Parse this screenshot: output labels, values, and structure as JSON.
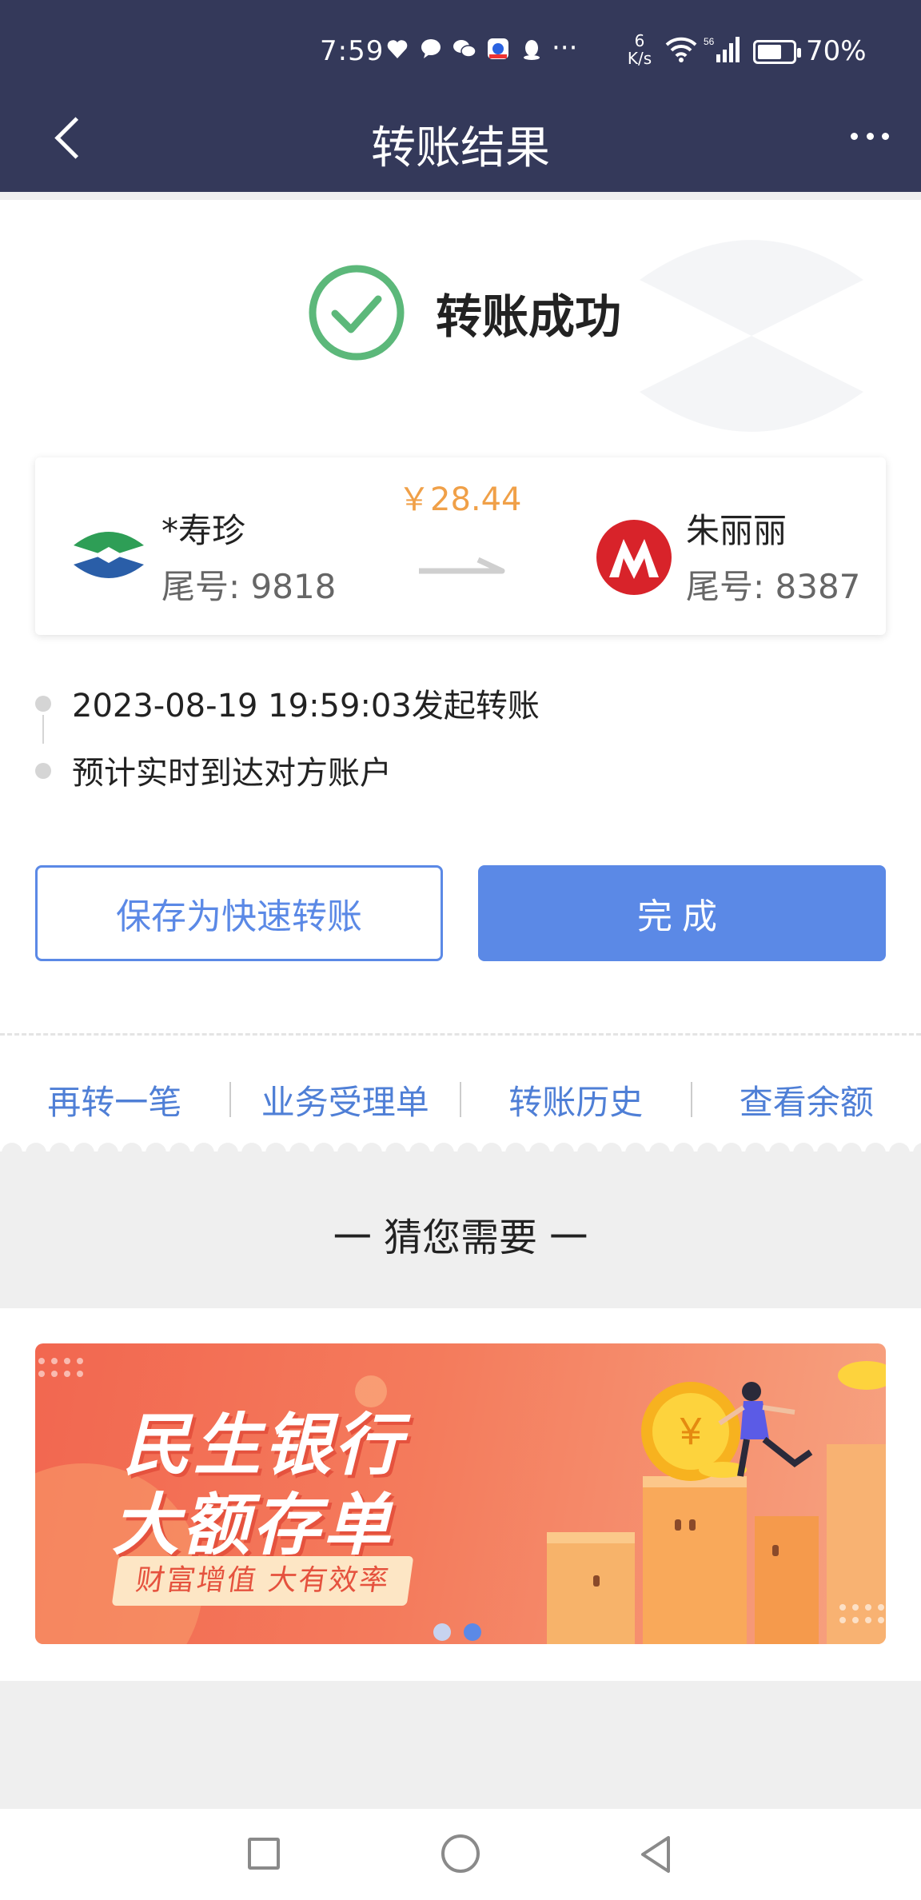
{
  "status_bar": {
    "time": "7:59",
    "more": "···",
    "net_speed_value": "6",
    "net_speed_unit": "K/s",
    "signal": "56",
    "battery": "70%"
  },
  "nav": {
    "title": "转账结果"
  },
  "result": {
    "status_text": "转账成功"
  },
  "transfer": {
    "amount": "￥28.44",
    "payer": {
      "name": "*寿珍",
      "tail": "尾号: 9818"
    },
    "payee": {
      "name": "朱丽丽",
      "tail": "尾号: 8387"
    }
  },
  "timeline": [
    "2023-08-19 19:59:03发起转账",
    "预计实时到达对方账户"
  ],
  "buttons": {
    "save_quick": "保存为快速转账",
    "done": "完成"
  },
  "links": [
    "再转一笔",
    "业务受理单",
    "转账历史",
    "查看余额"
  ],
  "recommend": {
    "title": "一 猜您需要 一",
    "banner": {
      "line1": "民生银行",
      "line2": "大额存单",
      "sub": "财富增值 大有效率",
      "coin_symbol": "¥"
    }
  },
  "colors": {
    "header": "#34395a",
    "accent": "#5b89e6",
    "amount": "#f0a048",
    "success": "#5cb87a"
  }
}
